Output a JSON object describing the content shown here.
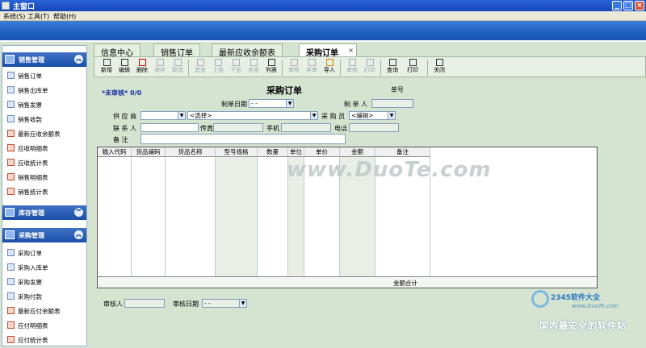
{
  "window": {
    "title": "主窗口",
    "minimize": "_",
    "maximize": "□",
    "close": "×"
  },
  "menu": {
    "items": [
      "系统(S)",
      "工具(T)",
      "帮助(H)"
    ]
  },
  "sidebar": {
    "groups": [
      {
        "label": "销售管理",
        "toggle": "︽",
        "items": [
          "销售订单",
          "销售出库单",
          "销售发票",
          "销售收款",
          "最新应收余额表",
          "应收明细表",
          "应收统计表",
          "销售明细表",
          "销售统计表"
        ]
      },
      {
        "label": "库存管理",
        "toggle": "︾",
        "items": []
      },
      {
        "label": "采购管理",
        "toggle": "︽",
        "items": [
          "采购订单",
          "采购入库单",
          "采购发票",
          "采购付款",
          "最新应付余额表",
          "应付明细表",
          "应付统计表"
        ]
      }
    ]
  },
  "tabs": [
    "信息中心",
    "销售订单",
    "最新应收余额表",
    "采购订单"
  ],
  "tab_close": "×",
  "toolbar": {
    "buttons": [
      "新增",
      "编辑",
      "删除",
      "保存",
      "取消",
      "首张",
      "上张",
      "下张",
      "末张",
      "列表",
      "审核",
      "弃审",
      "导入",
      "审核",
      "打印",
      "查询",
      "打印",
      "关闭"
    ]
  },
  "form": {
    "status": "*未审核* 0/0",
    "title": "采购订单",
    "doc_no_label": "单号",
    "date_label": "制单日期",
    "date_value": "- -",
    "maker_label": "制 单 人",
    "supplier_label": "供 应 商",
    "supplier_select": "<选择>",
    "buyer_label": "采 购 员",
    "buyer_select": "<编辑>",
    "contact_label": "联 系 人",
    "fax_label": "传真",
    "mobile_label": "手机",
    "phone_label": "电话",
    "remark_label": "备 注",
    "columns": [
      "输入代码",
      "货品编码",
      "货品名称",
      "型号规格",
      "数量",
      "单位",
      "单价",
      "金额",
      "备注"
    ],
    "total_label": "金额合计",
    "auditor_label": "审核人",
    "audit_date_label": "审核日期",
    "audit_date_value": "- -"
  },
  "watermark": "www.DuoTe.com",
  "logo": {
    "top": "2345软件大全",
    "url": "www.DuoTe.com",
    "bottom": "国内最安全的软件站"
  }
}
